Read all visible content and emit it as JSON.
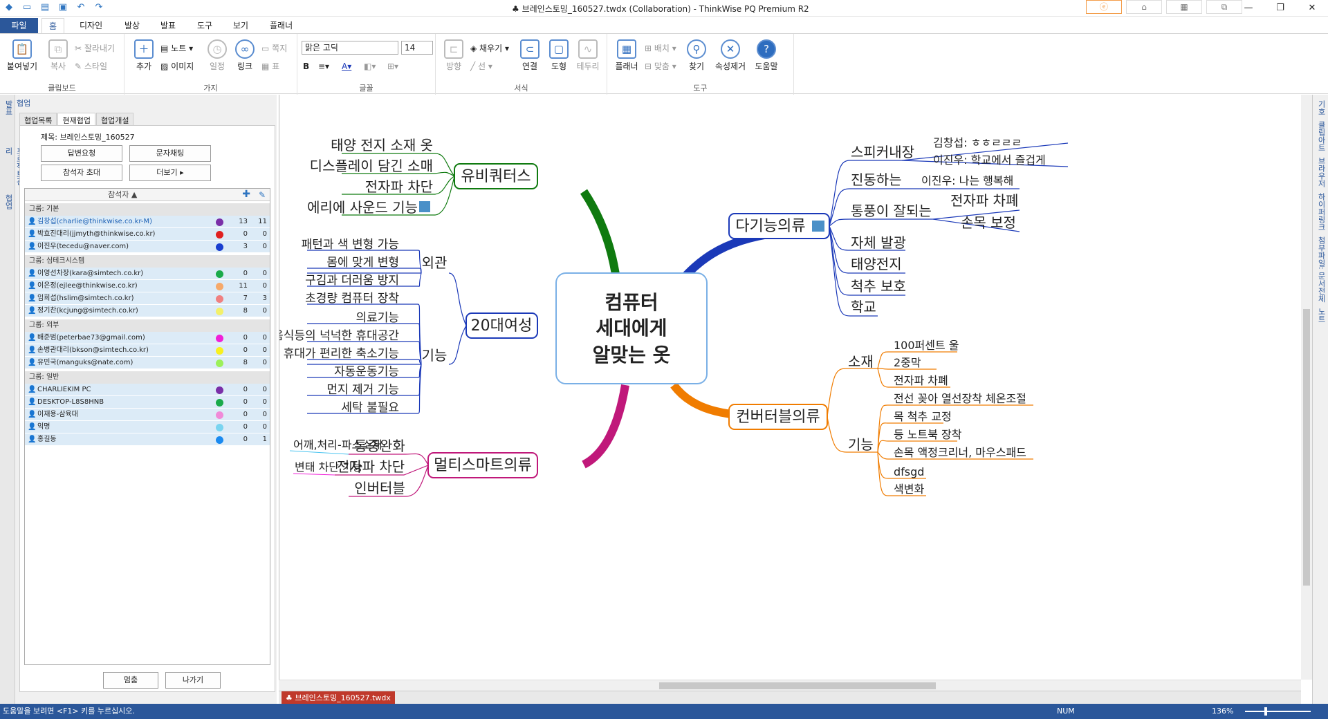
{
  "window": {
    "title": "♣ 브레인스토밍_160527.twdx (Collaboration) - ThinkWise PQ Premium R2",
    "minimize": "—",
    "maximize": "❐",
    "close": "✕"
  },
  "tabs": [
    "파일",
    "홈",
    "디자인",
    "발상",
    "발표",
    "도구",
    "보기",
    "플래너"
  ],
  "ribbon": {
    "clipboard": {
      "label": "클립보드",
      "paste": "붙여넣기",
      "copy": "복사",
      "cut": "잘라내기",
      "style": "스타일"
    },
    "branch": {
      "label": "가지",
      "add": "추가",
      "note": "노트",
      "image": "이미지",
      "schedule": "일정",
      "link": "링크",
      "memo": "쪽지",
      "table": "표"
    },
    "font": {
      "label": "글꼴",
      "family": "맑은 고딕",
      "size": "14",
      "bold": "B"
    },
    "format": {
      "label": "서식",
      "fill": "채우기",
      "direction": "방향",
      "line": "선",
      "connect": "연결",
      "shape": "도형",
      "border": "테두리"
    },
    "tools": {
      "label": "도구",
      "planner": "플래너",
      "arrange": "배치",
      "fit": "맞춤",
      "find": "찾기",
      "clear": "속성제거",
      "help": "도움말"
    }
  },
  "left_vtabs": [
    "발표",
    "프로젝트관리",
    "협업"
  ],
  "panel": {
    "header": "협업",
    "tabs": [
      "협업목록",
      "현재협업",
      "협업개설"
    ],
    "subject": "제목: 브레인스토밍_160527",
    "buttons": {
      "answer": "답변요청",
      "chat": "문자채팅",
      "invite": "참석자 초대",
      "more": "더보기"
    },
    "list_header": "참석자",
    "groups": [
      {
        "name": "그룹: 기본",
        "members": [
          {
            "name": "김창섭(charlie@thinkwise.co.kr-M)",
            "color": "#7a2fa8",
            "n1": "13",
            "n2": "11"
          },
          {
            "name": "박효진대리(jjmyth@thinkwise.co.kr)",
            "color": "#e02020",
            "n1": "0",
            "n2": "0"
          },
          {
            "name": "이진우(tecedu@naver.com)",
            "color": "#1a3fcf",
            "n1": "3",
            "n2": "0"
          }
        ]
      },
      {
        "name": "그룹: 심테크시스템",
        "members": [
          {
            "name": "이영선차장(kara@simtech.co.kr)",
            "color": "#1aaa4a",
            "n1": "0",
            "n2": "0"
          },
          {
            "name": "이은정(ejlee@thinkwise.co.kr)",
            "color": "#f6a96a",
            "n1": "11",
            "n2": "0"
          },
          {
            "name": "임희섭(hslim@simtech.co.kr)",
            "color": "#f08080",
            "n1": "7",
            "n2": "3"
          },
          {
            "name": "정기찬(kcjung@simtech.co.kr)",
            "color": "#f3f06a",
            "n1": "8",
            "n2": "0"
          }
        ]
      },
      {
        "name": "그룹: 외부",
        "members": [
          {
            "name": "배준범(peterbae73@gmail.com)",
            "color": "#f020d8",
            "n1": "0",
            "n2": "0"
          },
          {
            "name": "손병관대리(bkson@simtech.co.kr)",
            "color": "#f8f020",
            "n1": "0",
            "n2": "0"
          },
          {
            "name": "유민국(manguks@nate.com)",
            "color": "#9cf05a",
            "n1": "8",
            "n2": "0"
          }
        ]
      },
      {
        "name": "그룹: 일반",
        "members": [
          {
            "name": "CHARLIEKIM PC",
            "color": "#7a2fa8",
            "n1": "0",
            "n2": "0"
          },
          {
            "name": "DESKTOP-L8S8HNB",
            "color": "#1aaa4a",
            "n1": "0",
            "n2": "0"
          },
          {
            "name": "이재용-삼육대",
            "color": "#f08ad8",
            "n1": "0",
            "n2": "0"
          },
          {
            "name": "익명",
            "color": "#7ad4f0",
            "n1": "0",
            "n2": "0"
          },
          {
            "name": "홍길동",
            "color": "#1a8af0",
            "n1": "0",
            "n2": "1"
          }
        ]
      }
    ],
    "footer": {
      "stop": "멈춤",
      "exit": "나가기"
    }
  },
  "mindmap": {
    "center": [
      "컴퓨터",
      "세대에게",
      "알맞는 옷"
    ],
    "ubiquitous": {
      "label": "유비쿼터스",
      "children": [
        "태양 전지 소재 옷",
        "디스플레이 담긴 소매",
        "전자파 차단",
        "에리에 사운드 기능"
      ]
    },
    "twenties": {
      "label": "20대여성",
      "look": "외관",
      "look_children": [
        "패턴과 색 변형 가능",
        "몸에 맞게 변형",
        "구김과 더러움 방지"
      ],
      "func": "기능",
      "func_children": [
        "초경량 컴퓨터 장착",
        "의료기능",
        "음식등의 넉넉한 휴대공간",
        "휴대가 편리한 축소기능",
        "자동운동기능",
        "먼지 제거 기능",
        "세탁 불필요"
      ]
    },
    "multi_smart": {
      "label": "멀티스마트의류",
      "children": [
        "통증완화",
        "전자파 차단",
        "인버터블"
      ],
      "pain_note": "어깨,처리-파스소재",
      "emf_note": "변태 차단 기능"
    },
    "multi": {
      "label": "다기능의류",
      "speaker": "스피커내장",
      "speaker_notes": [
        "김창섭: ㅎㅎㄹㄹㄹ",
        "이진우: 학교에서 즐겁게"
      ],
      "vibrate": "진동하는",
      "vibrate_note": "이진우: 나는 행복해",
      "airy": "통풍이 잘되는",
      "airy_children": [
        "전자파 차폐",
        "손목 보정"
      ],
      "others": [
        "자체 발광",
        "태양전지",
        "척추 보호",
        "학교"
      ]
    },
    "convertible": {
      "label": "컨버터블의류",
      "material": "소재",
      "material_children": [
        "100퍼센트 울",
        "2중막",
        "전자파 차폐"
      ],
      "func": "기능",
      "func_children": [
        "전선 꽂아 열선장착 체온조절",
        "목 척추 교정",
        "등 노트북 장착",
        "손목 액정크리너, 마우스패드",
        "dfsgd",
        "색변화"
      ]
    }
  },
  "right_vtabs": [
    "기호",
    "클립아트",
    "브라우저",
    "하이퍼링크",
    "첨부파일: 문서전체",
    "노트"
  ],
  "doc_tab": "♣ 브레인스토밍_160527.twdx",
  "status": {
    "help": "도움말을 보려면 <F1> 키를 누르십시오.",
    "num": "NUM",
    "zoom": "136%"
  },
  "colors": {
    "accent": "#2b579a",
    "green": "#0f7a0f",
    "blue": "#1b39b8",
    "magenta": "#c0187a",
    "orange": "#f07c00",
    "twenties": "#1b39b8"
  }
}
